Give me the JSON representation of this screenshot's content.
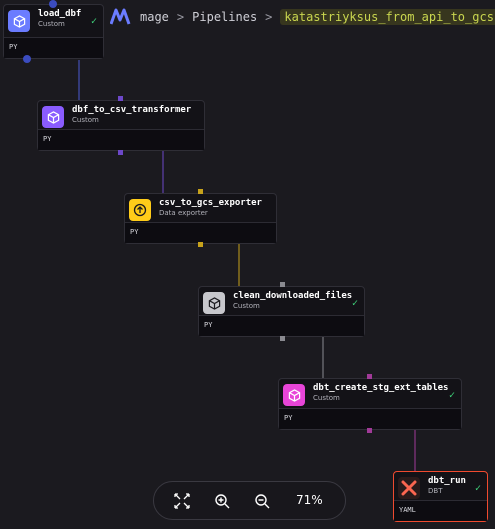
{
  "breadcrumb": {
    "app": "mage",
    "section": "Pipelines",
    "pipeline": "katastriyksus_from_api_to_gcs",
    "separator": ">"
  },
  "nodes": [
    {
      "name": "load_dbf",
      "type": "Custom",
      "lang": "PY",
      "status": "success",
      "color": "#6b7cff"
    },
    {
      "name": "dbf_to_csv_transformer",
      "type": "Custom",
      "lang": "PY",
      "status": "success",
      "color": "#8a5cff"
    },
    {
      "name": "csv_to_gcs_exporter",
      "type": "Data exporter",
      "lang": "PY",
      "status": "success",
      "color": "#ffcc19"
    },
    {
      "name": "clean_downloaded_files",
      "type": "Custom",
      "lang": "PY",
      "status": "success",
      "color": "#c7c7cc"
    },
    {
      "name": "dbt_create_stg_ext_tables",
      "type": "Custom",
      "lang": "PY",
      "status": "success",
      "color": "#e845d8"
    },
    {
      "name": "dbt_run",
      "type": "DBT",
      "lang": "YAML",
      "status": "success",
      "color": "#fc6650"
    }
  ],
  "controls": {
    "zoom_level": "71%",
    "icons": [
      "fit-view-icon",
      "zoom-in-icon",
      "zoom-out-icon"
    ]
  },
  "colors": {
    "background": "#1b1a1f",
    "success": "#3fd67c",
    "highlight_text": "#c9d64f"
  }
}
